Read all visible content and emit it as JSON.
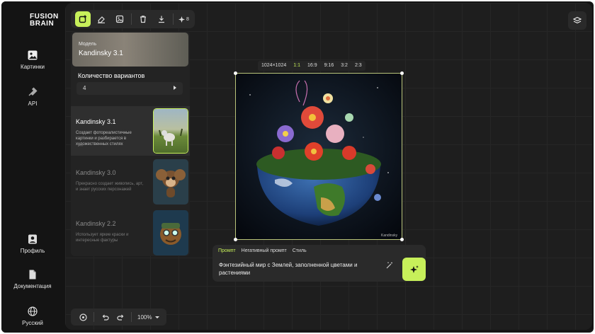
{
  "logo": {
    "line1": "FUSION",
    "line2": "BRAIN"
  },
  "sidebar": {
    "items": [
      {
        "label": "Картинки",
        "icon": "image-icon"
      },
      {
        "label": "API",
        "icon": "plug-icon"
      },
      {
        "label": "Профиль",
        "icon": "profile-icon"
      },
      {
        "label": "Документация",
        "icon": "document-icon"
      },
      {
        "label": "Русский",
        "icon": "globe-icon"
      }
    ]
  },
  "toolbar": {
    "tools": [
      "frame-add-icon",
      "eraser-icon",
      "image-edit-icon",
      "trash-icon",
      "download-icon"
    ],
    "credits_count": "8"
  },
  "panel": {
    "model_label": "Модель",
    "model_value": "Kandinsky 3.1",
    "variants_label": "Количество вариантов",
    "variants_value": "4",
    "models": [
      {
        "name": "Kandinsky 3.1",
        "desc": "Создает фотореалистичные картинки и разбирается в художественных стилях",
        "selected": true
      },
      {
        "name": "Kandinsky 3.0",
        "desc": "Прекрасно создает живопись, арт, и знает русских персонажей",
        "selected": false
      },
      {
        "name": "Kandinsky 2.2",
        "desc": "Использует яркие краски и интересные фактуры",
        "selected": false
      }
    ]
  },
  "canvas": {
    "ratios": [
      "1024×1024",
      "1:1",
      "16:9",
      "9:16",
      "3:2",
      "2:3"
    ],
    "active_ratio": "1:1",
    "watermark": "Kandinsky"
  },
  "prompt": {
    "tabs": [
      "Промпт",
      "Негативный промпт",
      "Стиль"
    ],
    "active_tab": "Промпт",
    "text": "Фэнтезийный мир с Землей, заполненной цветами и растениями"
  },
  "bottom": {
    "zoom": "100%"
  },
  "colors": {
    "accent": "#c7f05a",
    "bg": "#141414",
    "canvas": "#1e1e1e",
    "panel": "#232323"
  }
}
